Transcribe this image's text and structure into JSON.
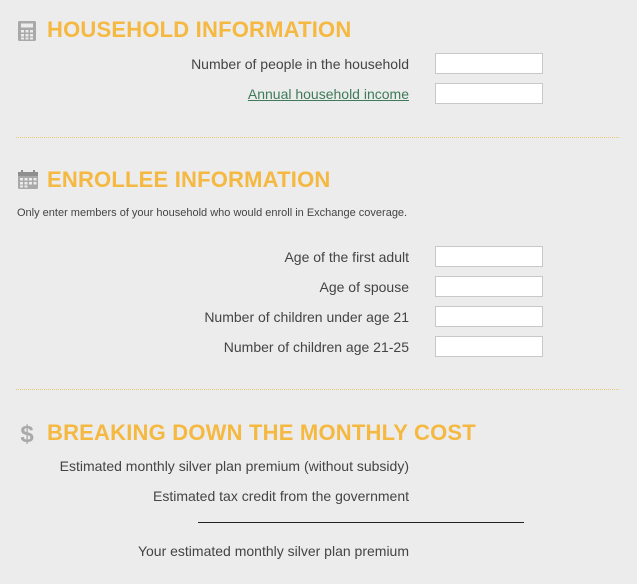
{
  "household": {
    "title": "HOUSEHOLD INFORMATION",
    "icon": "calculator-icon",
    "fields": [
      {
        "label": "Number of people in the household",
        "value": ""
      },
      {
        "label": "Annual household income",
        "value": "",
        "is_link": true
      }
    ]
  },
  "enrollee": {
    "title": "ENROLLEE INFORMATION",
    "icon": "calendar-icon",
    "note": "Only enter members of your household who would enroll in Exchange coverage.",
    "fields": [
      {
        "label": "Age of the first adult",
        "value": ""
      },
      {
        "label": "Age of spouse",
        "value": ""
      },
      {
        "label": "Number of children under age 21",
        "value": ""
      },
      {
        "label": "Number of children age 21-25",
        "value": ""
      }
    ]
  },
  "cost": {
    "title": "BREAKING DOWN THE MONTHLY COST",
    "icon": "dollar-icon",
    "lines": [
      {
        "label": "Estimated monthly silver plan premium (without subsidy)"
      },
      {
        "label": "Estimated tax credit from the government"
      },
      {
        "label": "Your estimated monthly silver plan premium"
      }
    ]
  },
  "colors": {
    "heading": "#f5b840",
    "link": "#3f7a5a",
    "background": "#ececec",
    "icon": "#a9a9a9"
  }
}
